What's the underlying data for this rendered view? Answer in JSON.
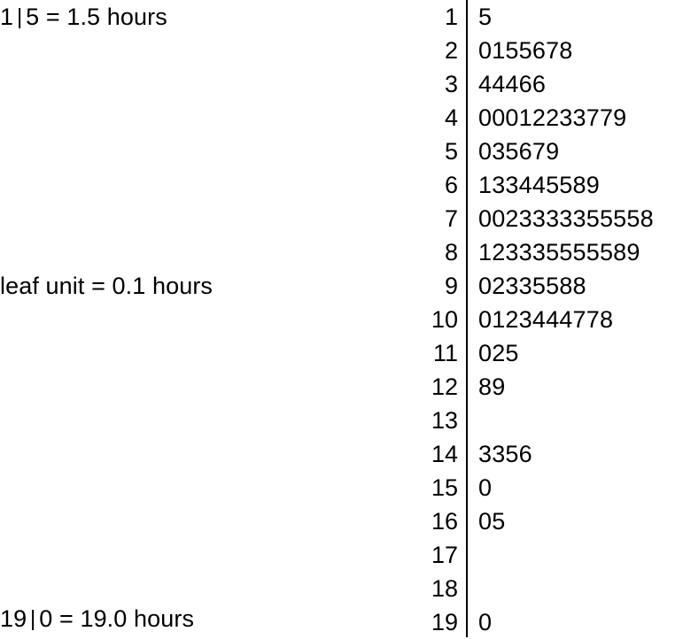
{
  "chart_data": {
    "type": "table",
    "title": "",
    "subtitle": "",
    "plot_kind": "stem-and-leaf",
    "xlabel": "",
    "ylabel": "",
    "units": "hours",
    "leaf_unit": 0.1,
    "stem_unit": 1,
    "stems": [
      1,
      2,
      3,
      4,
      5,
      6,
      7,
      8,
      9,
      10,
      11,
      12,
      13,
      14,
      15,
      16,
      17,
      18,
      19
    ],
    "leaves": [
      "5",
      "0155678",
      "44466",
      "00012233779",
      "035679",
      "133445589",
      "0023333355558",
      "123335555589",
      "02335588",
      "0123444778",
      "025",
      "89",
      "",
      "3356",
      "0",
      "05",
      "",
      "",
      "0"
    ],
    "rows": [
      {
        "stem": "1",
        "leaf": "5"
      },
      {
        "stem": "2",
        "leaf": "0155678"
      },
      {
        "stem": "3",
        "leaf": "44466"
      },
      {
        "stem": "4",
        "leaf": "00012233779"
      },
      {
        "stem": "5",
        "leaf": "035679"
      },
      {
        "stem": "6",
        "leaf": "133445589"
      },
      {
        "stem": "7",
        "leaf": "0023333355558"
      },
      {
        "stem": "8",
        "leaf": "123335555589"
      },
      {
        "stem": "9",
        "leaf": "02335588"
      },
      {
        "stem": "10",
        "leaf": "0123444778"
      },
      {
        "stem": "11",
        "leaf": "025"
      },
      {
        "stem": "12",
        "leaf": "89"
      },
      {
        "stem": "13",
        "leaf": ""
      },
      {
        "stem": "14",
        "leaf": "3356"
      },
      {
        "stem": "15",
        "leaf": "0"
      },
      {
        "stem": "16",
        "leaf": "05"
      },
      {
        "stem": "17",
        "leaf": ""
      },
      {
        "stem": "18",
        "leaf": ""
      },
      {
        "stem": "19",
        "leaf": "0"
      }
    ],
    "values": [
      1.5,
      2.0,
      2.1,
      2.5,
      2.5,
      2.6,
      2.7,
      2.8,
      3.4,
      3.4,
      3.4,
      3.6,
      3.6,
      4.0,
      4.0,
      4.0,
      4.1,
      4.2,
      4.2,
      4.3,
      4.3,
      4.7,
      4.7,
      4.9,
      5.0,
      5.3,
      5.5,
      5.6,
      5.7,
      5.9,
      6.1,
      6.3,
      6.3,
      6.4,
      6.4,
      6.5,
      6.5,
      6.8,
      6.9,
      7.0,
      7.0,
      7.2,
      7.3,
      7.3,
      7.3,
      7.3,
      7.3,
      7.5,
      7.5,
      7.5,
      7.5,
      7.8,
      8.1,
      8.2,
      8.3,
      8.3,
      8.3,
      8.5,
      8.5,
      8.5,
      8.5,
      8.5,
      8.8,
      8.9,
      9.0,
      9.2,
      9.3,
      9.3,
      9.5,
      9.5,
      9.8,
      9.8,
      10.0,
      10.1,
      10.2,
      10.3,
      10.4,
      10.4,
      10.4,
      10.7,
      10.7,
      10.8,
      11.0,
      11.2,
      11.5,
      12.8,
      12.9,
      14.3,
      14.3,
      14.5,
      14.6,
      15.0,
      16.0,
      16.5,
      19.0
    ],
    "annotations": [
      {
        "id": "key-top",
        "stem": "1",
        "separator": "|",
        "leaf": "5",
        "equals": "=",
        "value": "1.5 hours",
        "text": "1 | 5 = 1.5 hours"
      },
      {
        "id": "leaf-unit",
        "text": "leaf unit = 0.1 hours"
      },
      {
        "id": "key-bottom",
        "stem": "19",
        "separator": "|",
        "leaf": "0",
        "equals": "=",
        "value": "19.0 hours",
        "text": "19 | 0 = 19.0 hours"
      }
    ],
    "grid": false,
    "legend": "none",
    "colors": {
      "background": "#ffffff",
      "text": "#000000",
      "divider": "#000000"
    }
  }
}
